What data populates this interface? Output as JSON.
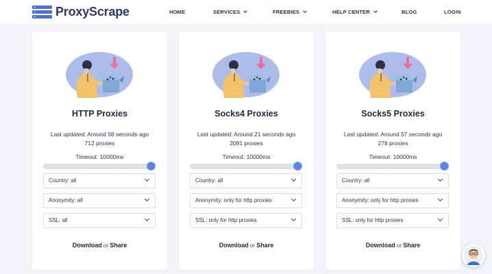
{
  "brand": {
    "name": "ProxyScrape",
    "color": "#4e72c6"
  },
  "nav": [
    {
      "label": "HOME",
      "has_dropdown": false
    },
    {
      "label": "SERVICES",
      "has_dropdown": true
    },
    {
      "label": "FREEBIES",
      "has_dropdown": true
    },
    {
      "label": "HELP CENTER",
      "has_dropdown": true
    },
    {
      "label": "BLOG",
      "has_dropdown": false
    },
    {
      "label": "LOGIN",
      "has_dropdown": false
    }
  ],
  "cards": [
    {
      "title": "HTTP Proxies",
      "updated": "Last updated: Around 58 seconds ago",
      "count": "712 proxies",
      "timeout": "Timeout: 10000ms",
      "timeout_slider_level": 1.0,
      "country": "Country: all",
      "anonymity": "Anonymity: all",
      "ssl": "SSL: all",
      "download": "Download",
      "or": "or",
      "share": "Share"
    },
    {
      "title": "Socks4 Proxies",
      "updated": "Last updated: Around 21 seconds ago",
      "count": "2081 proxies",
      "timeout": "Timeout: 10000ms",
      "timeout_slider_level": 1.0,
      "country": "Country: all",
      "anonymity": "Anonymity: only for http proxies",
      "ssl": "SSL: only for http proxies",
      "download": "Download",
      "or": "or",
      "share": "Share"
    },
    {
      "title": "Socks5 Proxies",
      "updated": "Last updated: Around 57 seconds ago",
      "count": "278 proxies",
      "timeout": "Timeout: 10000ms",
      "timeout_slider_level": 1.0,
      "country": "Country: all",
      "anonymity": "Anonymity: only for http proxies",
      "ssl": "SSL: only for http proxies",
      "download": "Download",
      "or": "or",
      "share": "Share"
    }
  ],
  "colors": {
    "accent": "#5b86db",
    "illustration_blob": "#aebcea",
    "arrow": "#ea6f9e",
    "box": "#7fa8d8",
    "shirt": "#f3c46b"
  },
  "icons": {
    "chat": "support-avatar-icon",
    "dropdown": "chevron-down-icon",
    "logo": "server-stack-icon"
  }
}
